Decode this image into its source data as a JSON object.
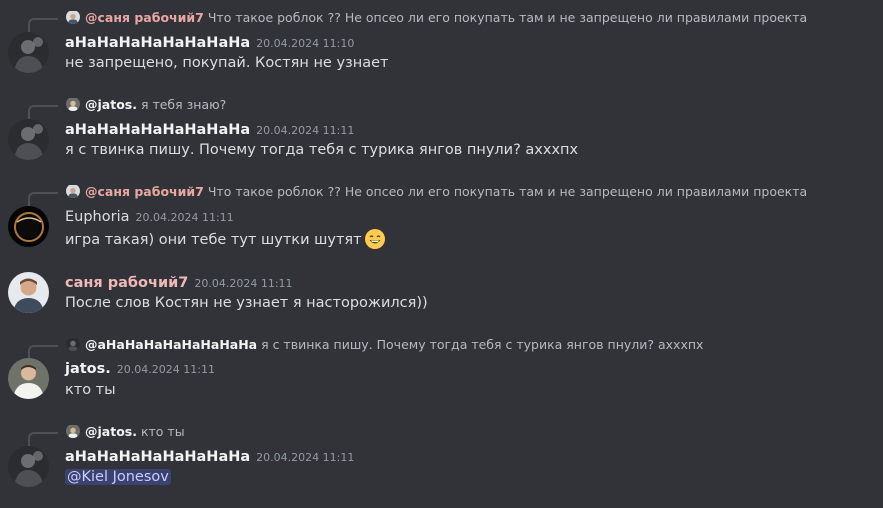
{
  "colors": {
    "background": "#313338",
    "author_white": "#f2f3f5",
    "author_pink": "#f0b8b8",
    "reply_author_pink": "#e8a7a2",
    "timestamp": "#949ba4",
    "text": "#dbdee1",
    "mention_bg": "#3c4270",
    "mention_text": "#c9cdfb"
  },
  "messages": [
    {
      "reply": {
        "author": "@саня рабочий7",
        "text": "Что такое роблок ?? Не опсео ли его покупать там и не запрещено ли правилами проекта"
      },
      "author": "аНаНаНаНаНаНаНаНа",
      "timestamp": "20.04.2024 11:10",
      "text": "не запрещено, покупай. Костян не узнает"
    },
    {
      "reply": {
        "author": "@jatos.",
        "text": "я тебя знаю?"
      },
      "author": "аНаНаНаНаНаНаНаНа",
      "timestamp": "20.04.2024 11:11",
      "text": "я с твинка пишу. Почему тогда тебя с турика янгов пнули? ахххпх"
    },
    {
      "reply": {
        "author": "@саня рабочий7",
        "text": "Что такое роблок ?? Не опсео ли его покупать там и не запрещено ли правилами проекта"
      },
      "author": "Euphoria",
      "timestamp": "20.04.2024 11:11",
      "text": "игра такая) они тебе тут шутки шутят",
      "emoji": "grinning-face-emoji"
    },
    {
      "author": "саня рабочий7",
      "timestamp": "20.04.2024 11:11",
      "text": "После слов Костян не узнает я насторожился))"
    },
    {
      "reply": {
        "author": "@аНаНаНаНаНаНаНаНа",
        "text": "я с твинка пишу. Почему тогда тебя с турика янгов пнули? ахххпх"
      },
      "author": "jatos.",
      "timestamp": "20.04.2024 11:11",
      "text": "кто ты"
    },
    {
      "reply": {
        "author": "@jatos.",
        "text": "кто ты"
      },
      "author": "аНаНаНаНаНаНаНаНа",
      "timestamp": "20.04.2024 11:11",
      "mention": "@Kiel Jonesov"
    }
  ]
}
